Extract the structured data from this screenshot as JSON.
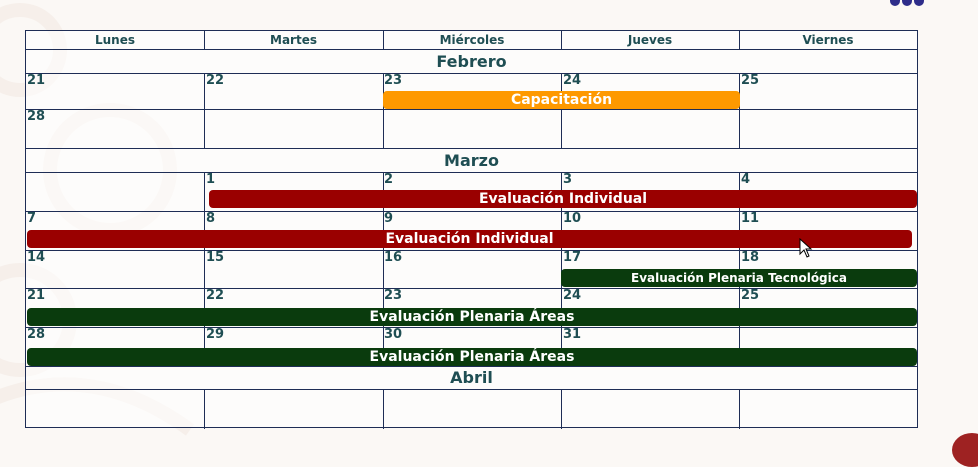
{
  "weekdays": [
    "Lunes",
    "Martes",
    "Miércoles",
    "Jueves",
    "Viernes"
  ],
  "months": {
    "febrero": "Febrero",
    "marzo": "Marzo",
    "abril": "Abril"
  },
  "dates": {
    "feb_w1": [
      "21",
      "22",
      "23",
      "24",
      "25"
    ],
    "feb_w2": [
      "28"
    ],
    "mar_w1": [
      "1",
      "2",
      "3",
      "4"
    ],
    "mar_w2": [
      "7",
      "8",
      "9",
      "10",
      "11"
    ],
    "mar_w3": [
      "14",
      "15",
      "16",
      "17",
      "18"
    ],
    "mar_w4": [
      "21",
      "22",
      "23",
      "24",
      "25"
    ],
    "mar_w5": [
      "28",
      "29",
      "30",
      "31"
    ]
  },
  "events": {
    "capacitacion": "Capacitación",
    "eval_individual_1": "Evaluación Individual",
    "eval_individual_2": "Evaluación Individual",
    "eval_plenaria_tec": "Evaluación Plenaria Tecnológica",
    "eval_plenaria_areas_1": "Evaluación Plenaria Áreas",
    "eval_plenaria_areas_2": "Evaluación Plenaria Áreas"
  },
  "colors": {
    "capacitacion": "#fe9900",
    "evaluacion_individual": "#9a0000",
    "evaluacion_plenaria": "#0a3b0d",
    "text": "#1f4e53",
    "grid": "#1e2d55"
  }
}
